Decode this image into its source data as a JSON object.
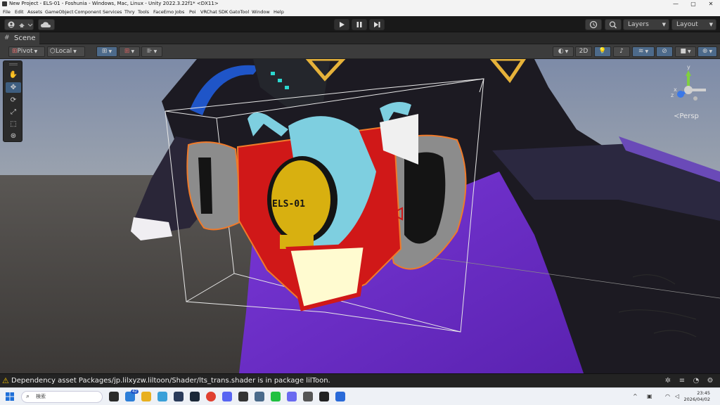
{
  "window": {
    "title": "New Project - ELS-01 - Foshunia - Windows, Mac, Linux - Unity 2022.3.22f1* <DX11>",
    "controls": [
      "—",
      "▢",
      "✕"
    ]
  },
  "menu": [
    "File",
    "Edit",
    "Assets",
    "GameObject",
    "Component",
    "Services",
    "Thry",
    "Tools",
    "FaceEmo",
    "Jobs",
    "Poi",
    "VRChat SDK",
    "GatoTool",
    "Window",
    "Help"
  ],
  "toolbar": {
    "layers_label": "Layers",
    "layout_label": "Layout"
  },
  "scene": {
    "tab_label": "Scene",
    "pivot_label": "Pivot",
    "local_label": "Local",
    "mode_2d_label": "2D",
    "persp_label": "≺Persp",
    "object_text": "ELS-01"
  },
  "gizmo_axes": {
    "x": "x",
    "y": "y",
    "z": "z"
  },
  "status": {
    "message": "Dependency asset Packages/jp.lilxyzw.liltoon/Shader/lts_trans.shader is in package lilToon."
  },
  "taskbar": {
    "search_placeholder": "検索",
    "badge_count": "42",
    "time": "23:45",
    "date": "2026/04/02"
  },
  "colors": {
    "editor_bg": "#191919",
    "accent": "#3e5e80",
    "warning": "#f0c000",
    "selection_outline": "#f07a2a"
  }
}
